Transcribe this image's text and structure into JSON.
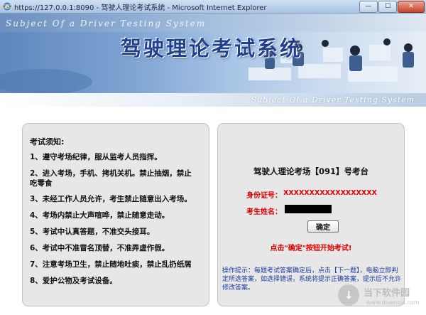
{
  "window": {
    "title": "https://127.0.0.1:8090 - 驾驶人理论考试系统 - Microsoft Internet Explorer",
    "minimize_label": "—",
    "maximize_label": "☐",
    "close_label": "✕"
  },
  "banner": {
    "subject_top": "Subject Of a Driver Testing System",
    "app_title": "驾驶理论考试系统",
    "subject_bottom": "Subject Of a Driver Testing System"
  },
  "rules": {
    "title": "考试须知:",
    "items": [
      "1、遵守考场纪律，服从监考人员指挥。",
      "2、进入考场，手机、拷机关机。禁止抽烟，禁止",
      "吃零食",
      "3、未经工作人员允许，考生禁止随意出入考场。",
      "4、考场内禁止大声喧哗，禁止随意走动。",
      "5、考试中认真答题，不准交头接耳。",
      "6、考试中不准冒名顶替，不准弄虚作假。",
      "7、注意考场卫生，禁止随地吐痰，禁止乱扔纸屑",
      "8、爱护公物及考试设备。"
    ]
  },
  "exam": {
    "room": "驾驶人理论考场【091】号考台",
    "id_label": "身份证号：",
    "id_value": "XXXXXXXXXXXXXXXXXX",
    "name_label": "考生姓名：",
    "confirm_label": "确定",
    "start_hint": "点击\"确定\"按钮开始考试!",
    "op_hint": "操作提示：每题考试答案确定后，点击【下一题】，电脑立即判定所选答案，如选择错误，系统将提示正确答案，提示后不允许修改答案。"
  },
  "watermark": {
    "name": "当下软件园",
    "url": "www.downxia.com"
  }
}
